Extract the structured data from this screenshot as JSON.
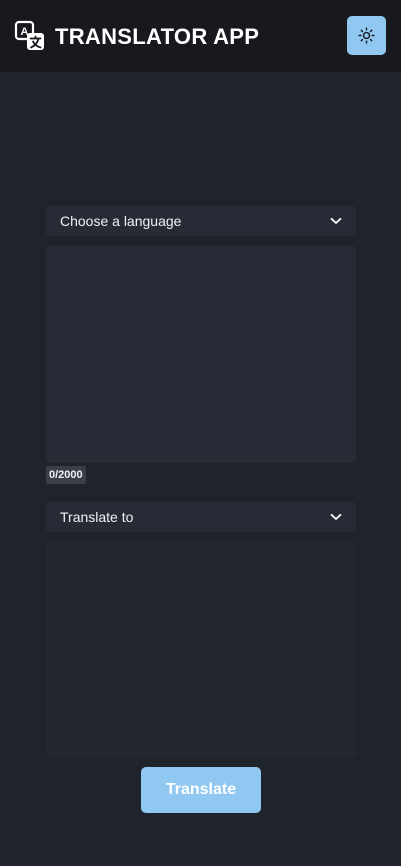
{
  "header": {
    "title": "TRANSLATOR APP",
    "logo_icon": "translate-icon",
    "theme_toggle_icon": "sun-icon",
    "accent_color": "#90c8f2"
  },
  "source": {
    "language_select_label": "Choose a language",
    "input_value": "",
    "char_count": "0/2000"
  },
  "target": {
    "language_select_label": "Translate to",
    "output_value": ""
  },
  "actions": {
    "translate_label": "Translate"
  }
}
